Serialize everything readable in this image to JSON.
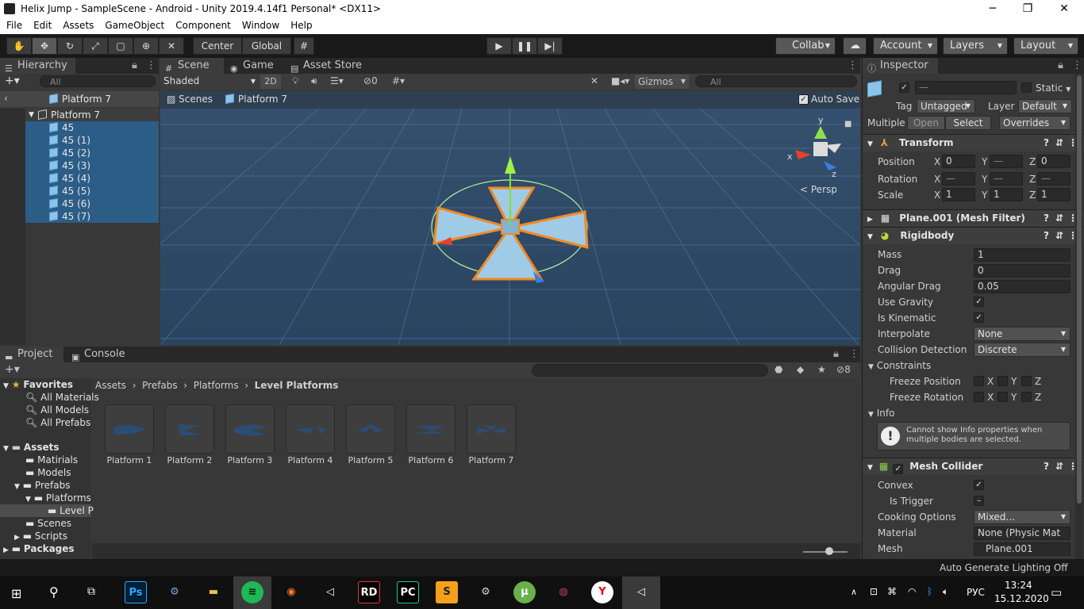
{
  "window": {
    "title": "Helix Jump - SampleScene - Android - Unity 2019.4.14f1 Personal* <DX11>",
    "minimize": "─",
    "maximize": "❐",
    "close": "✕"
  },
  "menu": [
    "File",
    "Edit",
    "Assets",
    "GameObject",
    "Component",
    "Window",
    "Help"
  ],
  "toolbar": {
    "pivot": "Center",
    "space": "Global",
    "collab": "Collab",
    "account": "Account",
    "layers": "Layers",
    "layout": "Layout"
  },
  "hierarchy": {
    "tab": "Hierarchy",
    "search": "All",
    "breadcrumb": "Platform 7",
    "root": "Platform 7",
    "children": [
      "45",
      "45 (1)",
      "45 (2)",
      "45 (3)",
      "45 (4)",
      "45 (5)",
      "45 (6)",
      "45 (7)"
    ]
  },
  "scene": {
    "tabs": [
      "Scene",
      "Game",
      "Asset Store"
    ],
    "shading": "Shaded",
    "mode2d": "2D",
    "hidden_count": "0",
    "gizmos": "Gizmos",
    "search": "All",
    "crumb_scenes": "Scenes",
    "crumb_object": "Platform 7",
    "autosave": "Auto Save",
    "persp": "Persp",
    "axis_x": "x",
    "axis_y": "y",
    "axis_z": "z"
  },
  "project": {
    "tabs": [
      "Project",
      "Console"
    ],
    "favorites": "Favorites",
    "fav_items": [
      "All Materials",
      "All Models",
      "All Prefabs"
    ],
    "assets": "Assets",
    "folders": [
      "Matirials",
      "Models",
      "Prefabs",
      "Platforms",
      "Level P",
      "Scenes",
      "Scripts"
    ],
    "packages": "Packages",
    "breadcrumb": [
      "Assets",
      "Prefabs",
      "Platforms",
      "Level Platforms"
    ],
    "items": [
      "Platform 1",
      "Platform 2",
      "Platform 3",
      "Platform 4",
      "Platform 5",
      "Platform 6",
      "Platform 7"
    ],
    "hidden_count": "8"
  },
  "inspector": {
    "tab": "Inspector",
    "name": "—",
    "static": "Static",
    "tag_label": "Tag",
    "tag": "Untagged",
    "layer_label": "Layer",
    "layer": "Default",
    "multiple": "Multiple",
    "open": "Open",
    "select": "Select",
    "overrides": "Overrides",
    "transform": {
      "title": "Transform",
      "position": [
        "0",
        "—",
        "0"
      ],
      "rotation": [
        "—",
        "—",
        "—"
      ],
      "scale": [
        "1",
        "1",
        "1"
      ],
      "labels": [
        "Position",
        "Rotation",
        "Scale"
      ]
    },
    "meshfilter": "Plane.001 (Mesh Filter)",
    "rigidbody": {
      "title": "Rigidbody",
      "mass_label": "Mass",
      "mass": "1",
      "drag_label": "Drag",
      "drag": "0",
      "angdrag_label": "Angular Drag",
      "angdrag": "0.05",
      "gravity_label": "Use Gravity",
      "kinematic_label": "Is Kinematic",
      "interp_label": "Interpolate",
      "interp": "None",
      "coll_label": "Collision Detection",
      "coll": "Discrete",
      "constraints": "Constraints",
      "freeze_pos": "Freeze Position",
      "freeze_rot": "Freeze Rotation",
      "info": "Info",
      "info_msg": "Cannot show Info properties when multiple bodies are selected."
    },
    "meshcollider": {
      "title": "Mesh Collider",
      "convex_label": "Convex",
      "trigger_label": "Is Trigger",
      "cooking_label": "Cooking Options",
      "cooking": "Mixed...",
      "material_label": "Material",
      "material": "None (Physic Mat",
      "mesh_label": "Mesh",
      "mesh": "Plane.001"
    }
  },
  "status": "Auto Generate Lighting Off",
  "taskbar": {
    "time": "13:24",
    "date": "15.12.2020",
    "lang": "РУС"
  },
  "colors": {
    "selection": "#2c5d87",
    "platform": "#9fcbe6",
    "outline": "#f08a24",
    "sky": "#35506e"
  }
}
